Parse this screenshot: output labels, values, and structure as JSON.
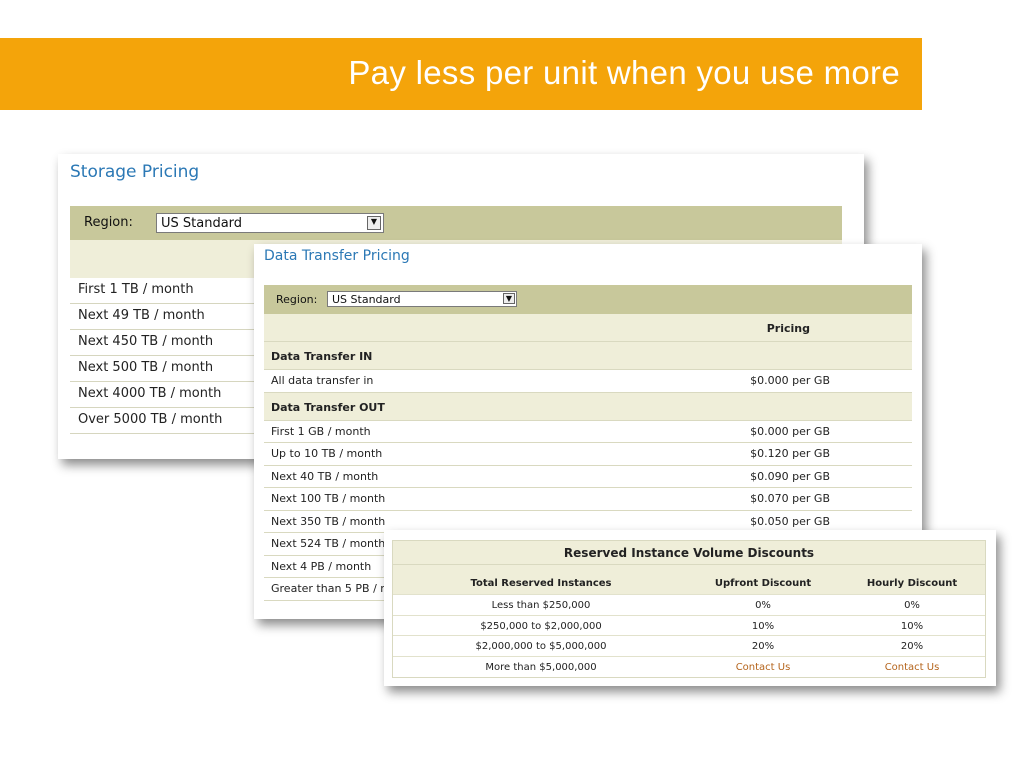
{
  "banner": {
    "title": "Pay less per unit when you use more",
    "color": "#f4a40a"
  },
  "storage": {
    "title": "Storage Pricing",
    "region_label": "Region:",
    "region_value": "US Standard",
    "rows": [
      "First 1 TB / month",
      "Next 49 TB / month",
      "Next 450 TB / month",
      "Next 500 TB / month",
      "Next 4000 TB / month",
      "Over 5000 TB / month"
    ]
  },
  "data_transfer": {
    "title": "Data Transfer Pricing",
    "region_label": "Region:",
    "region_value": "US Standard",
    "pricing_header": "Pricing",
    "in_section": "Data Transfer IN",
    "in_rows": [
      {
        "label": "All data transfer in",
        "price": "$0.000 per GB"
      }
    ],
    "out_section": "Data Transfer OUT",
    "out_rows": [
      {
        "label": "First 1 GB / month",
        "price": "$0.000 per GB"
      },
      {
        "label": "Up to 10 TB / month",
        "price": "$0.120 per GB"
      },
      {
        "label": "Next 40 TB / month",
        "price": "$0.090 per GB"
      },
      {
        "label": "Next 100 TB / month",
        "price": "$0.070 per GB"
      },
      {
        "label": "Next 350 TB / month",
        "price": "$0.050 per GB"
      },
      {
        "label": "Next 524 TB / month",
        "price": ""
      },
      {
        "label": "Next 4 PB / month",
        "price": ""
      },
      {
        "label": "Greater than 5 PB / month",
        "price": ""
      }
    ]
  },
  "reserved": {
    "title": "Reserved Instance Volume Discounts",
    "headers": [
      "Total Reserved Instances",
      "Upfront Discount",
      "Hourly Discount"
    ],
    "rows": [
      [
        "Less than $250,000",
        "0%",
        "0%"
      ],
      [
        "$250,000 to $2,000,000",
        "10%",
        "10%"
      ],
      [
        "$2,000,000 to $5,000,000",
        "20%",
        "20%"
      ],
      [
        "More than $5,000,000",
        "Contact Us",
        "Contact Us"
      ]
    ]
  }
}
